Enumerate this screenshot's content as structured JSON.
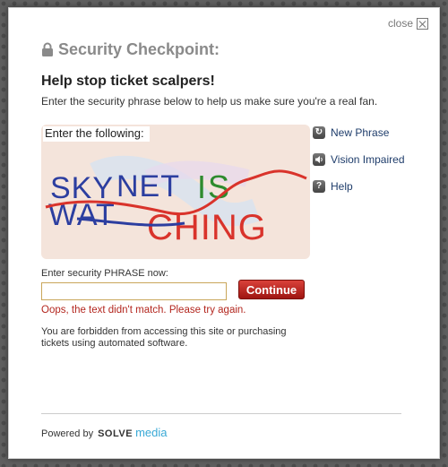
{
  "modal": {
    "close_label": "close",
    "header_title": "Security Checkpoint:",
    "headline": "Help stop ticket scalpers!",
    "subtitle": "Enter the security phrase below to help us make sure you're a real fan.",
    "captcha": {
      "prompt": "Enter the following:",
      "line1": "SKYNET IS",
      "line2": "WATCHING"
    },
    "side_links": [
      {
        "label": "New Phrase",
        "icon": "refresh-icon"
      },
      {
        "label": "Vision Impaired",
        "icon": "speaker-icon"
      },
      {
        "label": "Help",
        "icon": "help-icon"
      }
    ],
    "phrase_label": "Enter security PHRASE now:",
    "phrase_value": "",
    "continue_label": "Continue",
    "error_text": "Oops, the text didn't match. Please try again.",
    "notice_text": "You are forbidden from accessing this site or purchasing tickets using automated software.",
    "powered_by": "Powered by",
    "logo_solve": "SOLVE",
    "logo_media": "media"
  },
  "colors": {
    "error": "#b3261e",
    "continue_button": "#b5201a",
    "link": "#1f3d6b",
    "logo_media": "#39a9d6",
    "captcha_bg": "#f4e4db"
  }
}
